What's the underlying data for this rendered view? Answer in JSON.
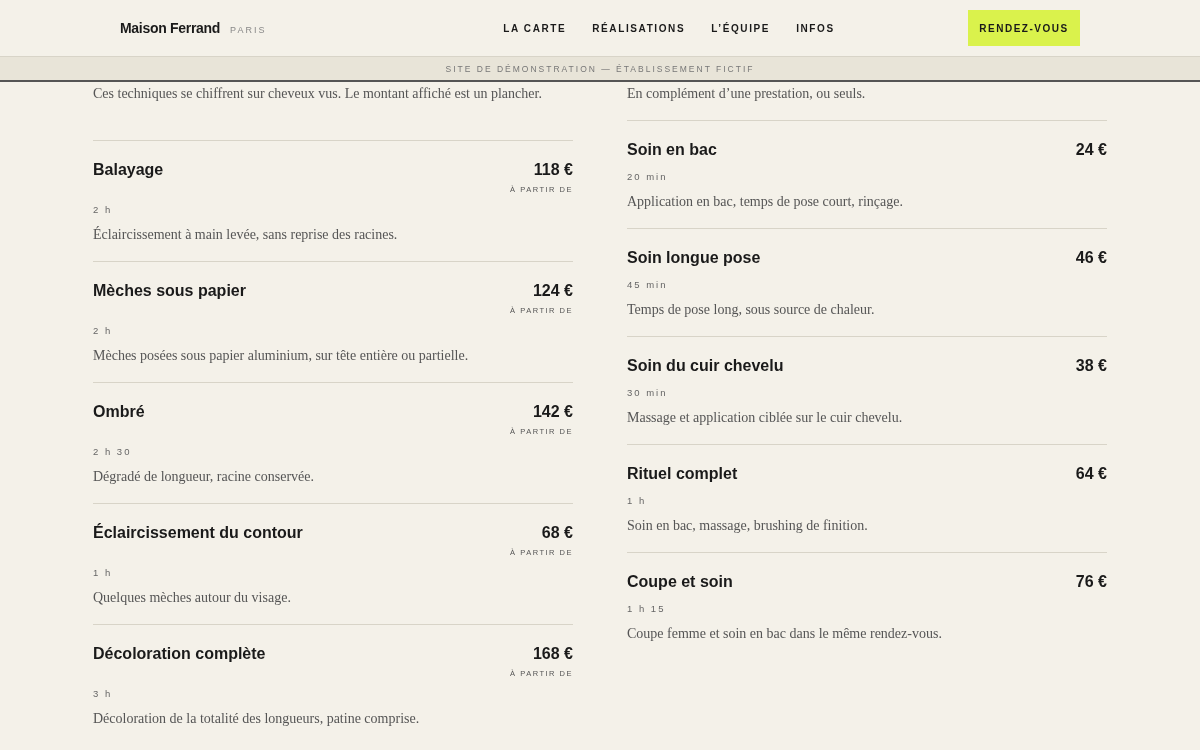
{
  "header": {
    "brand": "Maison Ferrand",
    "city": "PARIS",
    "nav": [
      {
        "label": "LA CARTE"
      },
      {
        "label": "RÉALISATIONS"
      },
      {
        "label": "L’ÉQUIPE"
      },
      {
        "label": "INFOS"
      }
    ],
    "cta": "RENDEZ-VOUS"
  },
  "banner": "SITE DE DÉMONSTRATION — ÉTABLISSEMENT FICTIF",
  "columns": [
    {
      "intro": "Ces techniques se chiffrent sur cheveux vus. Le montant affiché est un plancher.",
      "items": [
        {
          "name": "Balayage",
          "price": "118 €",
          "price_note": "À PARTIR DE",
          "duration": "2 h",
          "description": "Éclaircissement à main levée, sans reprise des racines."
        },
        {
          "name": "Mèches sous papier",
          "price": "124 €",
          "price_note": "À PARTIR DE",
          "duration": "2 h",
          "description": "Mèches posées sous papier aluminium, sur tête entière ou partielle."
        },
        {
          "name": "Ombré",
          "price": "142 €",
          "price_note": "À PARTIR DE",
          "duration": "2 h 30",
          "description": "Dégradé de longueur, racine conservée."
        },
        {
          "name": "Éclaircissement du contour",
          "price": "68 €",
          "price_note": "À PARTIR DE",
          "duration": "1 h",
          "description": "Quelques mèches autour du visage."
        },
        {
          "name": "Décoloration complète",
          "price": "168 €",
          "price_note": "À PARTIR DE",
          "duration": "3 h",
          "description": "Décoloration de la totalité des longueurs, patine comprise."
        }
      ]
    },
    {
      "intro": "En complément d’une prestation, ou seuls.",
      "items": [
        {
          "name": "Soin en bac",
          "price": "24 €",
          "duration": "20 min",
          "description": "Application en bac, temps de pose court, rinçage."
        },
        {
          "name": "Soin longue pose",
          "price": "46 €",
          "duration": "45 min",
          "description": "Temps de pose long, sous source de chaleur."
        },
        {
          "name": "Soin du cuir chevelu",
          "price": "38 €",
          "duration": "30 min",
          "description": "Massage et application ciblée sur le cuir chevelu."
        },
        {
          "name": "Rituel complet",
          "price": "64 €",
          "duration": "1 h",
          "description": "Soin en bac, massage, brushing de finition."
        },
        {
          "name": "Coupe et soin",
          "price": "76 €",
          "duration": "1 h 15",
          "description": "Coupe femme et soin en bac dans le même rendez-vous."
        }
      ]
    }
  ]
}
